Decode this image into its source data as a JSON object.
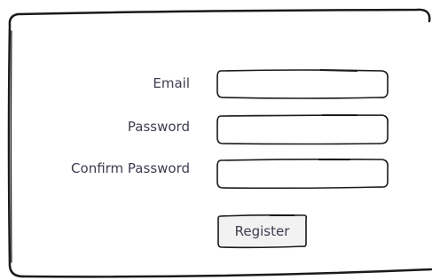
{
  "form": {
    "email_label": "Email",
    "email_value": "",
    "password_label": "Password",
    "password_value": "",
    "confirm_label": "Confirm Password",
    "confirm_value": "",
    "register_label": "Register"
  },
  "colors": {
    "stroke": "#1a1a1a",
    "text": "#3c3d4f",
    "button_fill": "#f2f2f2"
  }
}
